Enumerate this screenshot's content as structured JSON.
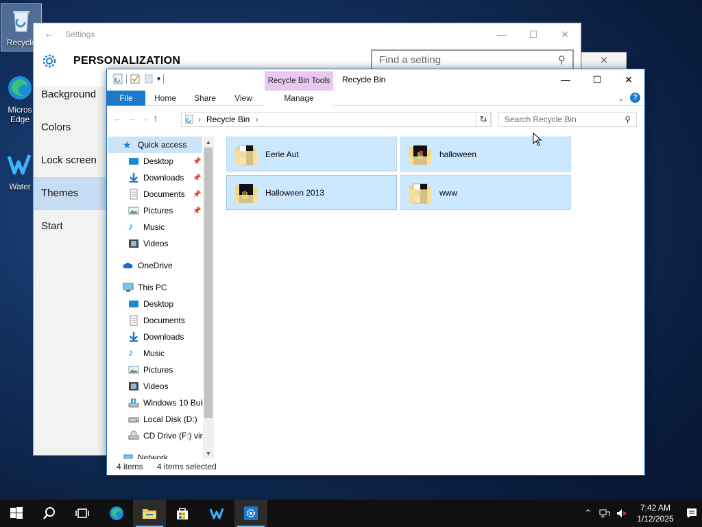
{
  "desktop": {
    "icons": [
      {
        "label": "Recycle"
      },
      {
        "label": "Micros Edge"
      },
      {
        "label": "Water"
      }
    ]
  },
  "settings": {
    "window_title": "Settings",
    "page_title": "PERSONALIZATION",
    "search_placeholder": "Find a setting",
    "nav": [
      {
        "label": "Background"
      },
      {
        "label": "Colors"
      },
      {
        "label": "Lock screen"
      },
      {
        "label": "Themes"
      },
      {
        "label": "Start"
      }
    ]
  },
  "explorer": {
    "tools_tab": "Recycle Bin Tools",
    "title": "Recycle Bin",
    "ribbon_tabs": {
      "file": "File",
      "home": "Home",
      "share": "Share",
      "view": "View",
      "manage": "Manage"
    },
    "address": {
      "crumb": "Recycle Bin"
    },
    "search_placeholder": "Search Recycle Bin",
    "nav_pane": {
      "quick_access": "Quick access",
      "quick_items": [
        "Desktop",
        "Downloads",
        "Documents",
        "Pictures",
        "Music",
        "Videos"
      ],
      "onedrive": "OneDrive",
      "this_pc": "This PC",
      "pc_items": [
        "Desktop",
        "Documents",
        "Downloads",
        "Music",
        "Pictures",
        "Videos",
        "Windows 10 Buil",
        "Local Disk (D:)",
        "CD Drive (F:) virt"
      ],
      "network": "Network"
    },
    "items": [
      {
        "name": "Eerie Aut"
      },
      {
        "name": "halloween"
      },
      {
        "name": "Halloween 2013"
      },
      {
        "name": "www"
      }
    ],
    "status": {
      "count": "4 items",
      "selected": "4 items selected"
    }
  },
  "taskbar": {
    "time": "7:42 AM",
    "date": "1/12/2025"
  },
  "colors": {
    "accent": "#1979ca",
    "selection": "#cce8ff",
    "tools_tab": "#e8c8f0"
  }
}
